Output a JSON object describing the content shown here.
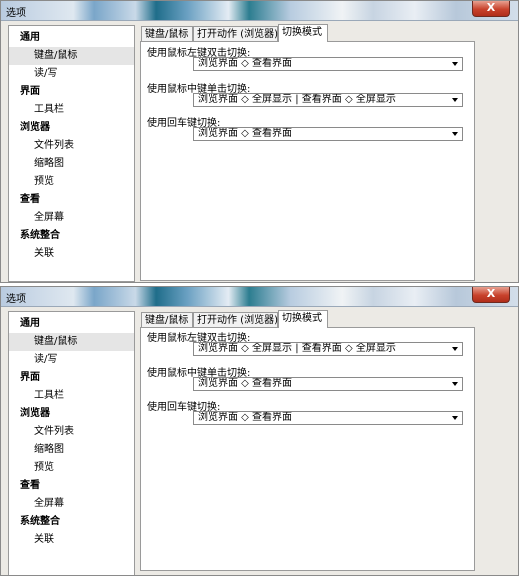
{
  "windows": [
    {
      "title": "选项",
      "close_symbol": "X",
      "tabs": [
        "键盘/鼠标",
        "打开动作 (浏览器)",
        "切换模式"
      ],
      "sidebar": [
        {
          "label": "通用",
          "type": "category"
        },
        {
          "label": "键盘/鼠标",
          "type": "item",
          "selected": true
        },
        {
          "label": "读/写",
          "type": "item"
        },
        {
          "label": "界面",
          "type": "category"
        },
        {
          "label": "工具栏",
          "type": "item"
        },
        {
          "label": "浏览器",
          "type": "category"
        },
        {
          "label": "文件列表",
          "type": "item"
        },
        {
          "label": "缩略图",
          "type": "item"
        },
        {
          "label": "预览",
          "type": "item"
        },
        {
          "label": "查看",
          "type": "category"
        },
        {
          "label": "全屏幕",
          "type": "item"
        },
        {
          "label": "系统整合",
          "type": "category"
        },
        {
          "label": "关联",
          "type": "item"
        }
      ],
      "settings": [
        {
          "label": "使用鼠标左键双击切换:",
          "value": "浏览界面 ◇ 查看界面"
        },
        {
          "label": "使用鼠标中键单击切换:",
          "value": "浏览界面 ◇ 全屏显示 | 查看界面 ◇ 全屏显示"
        },
        {
          "label": "使用回车键切换:",
          "value": "浏览界面 ◇ 查看界面"
        }
      ]
    },
    {
      "title": "选项",
      "close_symbol": "X",
      "tabs": [
        "键盘/鼠标",
        "打开动作 (浏览器)",
        "切换模式"
      ],
      "sidebar": [
        {
          "label": "通用",
          "type": "category"
        },
        {
          "label": "键盘/鼠标",
          "type": "item",
          "selected": true
        },
        {
          "label": "读/写",
          "type": "item"
        },
        {
          "label": "界面",
          "type": "category"
        },
        {
          "label": "工具栏",
          "type": "item"
        },
        {
          "label": "浏览器",
          "type": "category"
        },
        {
          "label": "文件列表",
          "type": "item"
        },
        {
          "label": "缩略图",
          "type": "item"
        },
        {
          "label": "预览",
          "type": "item"
        },
        {
          "label": "查看",
          "type": "category"
        },
        {
          "label": "全屏幕",
          "type": "item"
        },
        {
          "label": "系统整合",
          "type": "category"
        },
        {
          "label": "关联",
          "type": "item"
        }
      ],
      "settings": [
        {
          "label": "使用鼠标左键双击切换:",
          "value": "浏览界面 ◇ 全屏显示 | 查看界面 ◇ 全屏显示"
        },
        {
          "label": "使用鼠标中键单击切换:",
          "value": "浏览界面 ◇ 查看界面"
        },
        {
          "label": "使用回车键切换:",
          "value": "浏览界面 ◇ 查看界面"
        }
      ]
    }
  ]
}
